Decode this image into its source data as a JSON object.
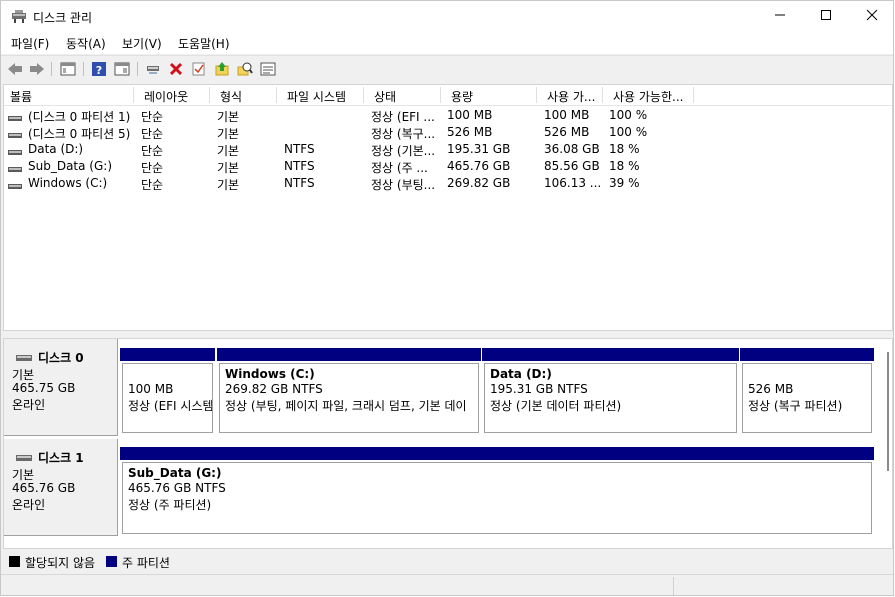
{
  "window": {
    "title": "디스크 관리",
    "app_icon": "disk-management-icon"
  },
  "window_controls": {
    "minimize": "minimize-icon",
    "maximize": "maximize-icon",
    "close": "close-icon"
  },
  "menu": [
    {
      "label": "파일(F)"
    },
    {
      "label": "동작(A)"
    },
    {
      "label": "보기(V)"
    },
    {
      "label": "도움말(H)"
    }
  ],
  "toolbar": [
    "back-icon",
    "forward-icon",
    "show-hide-console-tree-icon",
    "help-icon",
    "properties-icon",
    "connect-icon",
    "delete-icon",
    "check-icon",
    "up-icon",
    "search-icon",
    "settings-icon"
  ],
  "volume_table": {
    "columns": [
      "볼륨",
      "레이아웃",
      "형식",
      "파일 시스템",
      "상태",
      "용량",
      "사용 가...",
      "사용 가능한..."
    ],
    "rows": [
      [
        "(디스크 0 파티션 1)",
        "단순",
        "기본",
        "",
        "정상 (EFI ...",
        "100 MB",
        "100 MB",
        "100 %"
      ],
      [
        "(디스크 0 파티션 5)",
        "단순",
        "기본",
        "",
        "정상 (복구...",
        "526 MB",
        "526 MB",
        "100 %"
      ],
      [
        "Data (D:)",
        "단순",
        "기본",
        "NTFS",
        "정상 (기본...",
        "195.31 GB",
        "36.08 GB",
        "18 %"
      ],
      [
        "Sub_Data (G:)",
        "단순",
        "기본",
        "NTFS",
        "정상 (주 ...",
        "465.76 GB",
        "85.56 GB",
        "18 %"
      ],
      [
        "Windows (C:)",
        "단순",
        "기본",
        "NTFS",
        "정상 (부팅...",
        "269.82 GB",
        "106.13 ...",
        "39 %"
      ]
    ]
  },
  "disks": [
    {
      "name": "디스크 0",
      "type": "기본",
      "size": "465.75 GB",
      "status": "온라인",
      "partitions": [
        {
          "title": "",
          "size": "100 MB",
          "status": "정상 (EFI 시스템"
        },
        {
          "title": "Windows  (C:)",
          "size": "269.82 GB NTFS",
          "status": "정상 (부팅, 페이지 파일, 크래시 덤프, 기본 데이"
        },
        {
          "title": "Data  (D:)",
          "size": "195.31 GB NTFS",
          "status": "정상 (기본 데이터 파티션)"
        },
        {
          "title": "",
          "size": "526 MB",
          "status": "정상 (복구 파티션)"
        }
      ]
    },
    {
      "name": "디스크 1",
      "type": "기본",
      "size": "465.76 GB",
      "status": "온라인",
      "partitions": [
        {
          "title": "Sub_Data  (G:)",
          "size": "465.76 GB NTFS",
          "status": "정상 (주 파티션)"
        }
      ]
    }
  ],
  "legend": [
    {
      "label": "할당되지 않음",
      "color": "#000000"
    },
    {
      "label": "주 파티션",
      "color": "#000080"
    }
  ],
  "colors": {
    "primary_partition": "#000080",
    "unallocated": "#000000",
    "close": "#000000"
  }
}
